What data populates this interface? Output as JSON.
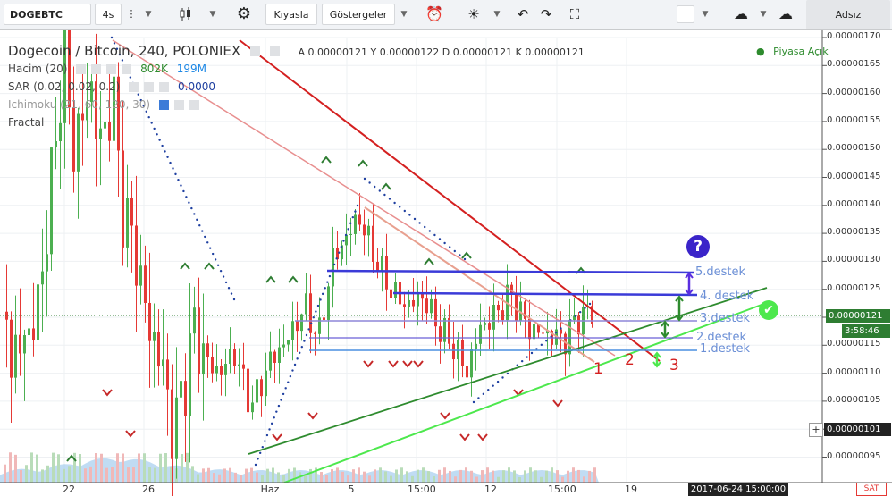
{
  "toolbar": {
    "symbol": "DOGEBTC",
    "interval": "4s",
    "compare_label": "Kıyasla",
    "indicators_label": "Göstergeler",
    "user_label": "Adsız"
  },
  "legend": {
    "title": "Dogecoin / Bitcoin, 240, POLONIEX",
    "ohlc": "A 0.00000121  Y 0.00000122  D 0.00000121  K 0.00000121",
    "market_status": "Piyasa Açık",
    "volume_label": "Hacim (20)",
    "volume_value1": "802K",
    "volume_value2": "199M",
    "sar_label": "SAR (0.02, 0.02, 0.2)",
    "sar_value": "0.0000",
    "ichimoku_label": "Ichimoku (21, 60, 120, 30)",
    "fractal_label": "Fractal"
  },
  "price_axis": {
    "ticks": [
      "0.00000170",
      "0.00000165",
      "0.00000160",
      "0.00000155",
      "0.00000150",
      "0.00000145",
      "0.00000140",
      "0.00000135",
      "0.00000130",
      "0.00000125",
      "0.00000120",
      "0.00000115",
      "0.00000110",
      "0.00000105",
      "0.00000100",
      "0.00000095"
    ],
    "current_price": "0.00000121",
    "countdown": "3:58:46",
    "crosshair_price": "0.00000101"
  },
  "time_axis": {
    "ticks": [
      "22",
      "26",
      "Haz",
      "5",
      "15:00",
      "12",
      "15:00",
      "19"
    ],
    "crosshair_time": "2017-06-24 15:00:00"
  },
  "annotations": {
    "support_labels": [
      "5.destek",
      "4. destek",
      "3.destek",
      "2.destek",
      "1.destek"
    ],
    "line_numbers": [
      "1",
      "2",
      "3"
    ],
    "question_mark": "?",
    "sell_label": "SAT"
  },
  "colors": {
    "up_candle": "#4caf50",
    "down_candle": "#e53935",
    "support_line": "#3b3bd8",
    "resistance_line": "#d42020",
    "trend_green": "#2e8b2e",
    "trend_light_green": "#4de84d"
  }
}
